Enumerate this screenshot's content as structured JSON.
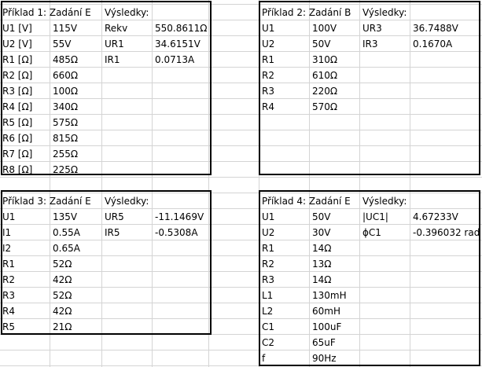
{
  "blocks": {
    "p1": {
      "title": "Příklad 1: Zadání E",
      "results_label": "Výsledky:",
      "inputs": [
        [
          "U1 [V]",
          "115V"
        ],
        [
          "U2 [V]",
          "55V"
        ],
        [
          "R1 [Ω]",
          "485Ω"
        ],
        [
          "R2 [Ω]",
          "660Ω"
        ],
        [
          "R3 [Ω]",
          "100Ω"
        ],
        [
          "R4 [Ω]",
          "340Ω"
        ],
        [
          "R5 [Ω]",
          "575Ω"
        ],
        [
          "R6 [Ω]",
          "815Ω"
        ],
        [
          "R7 [Ω]",
          "255Ω"
        ],
        [
          "R8 [Ω]",
          "225Ω"
        ]
      ],
      "results": [
        [
          "Rekv",
          "550.8611Ω"
        ],
        [
          "UR1",
          "34.6151V"
        ],
        [
          "IR1",
          "0.0713A"
        ]
      ]
    },
    "p2": {
      "title": "Příklad 2: Zadání B",
      "results_label": "Výsledky:",
      "inputs": [
        [
          "U1",
          "100V"
        ],
        [
          "U2",
          "50V"
        ],
        [
          "R1",
          "310Ω"
        ],
        [
          "R2",
          "610Ω"
        ],
        [
          "R3",
          "220Ω"
        ],
        [
          "R4",
          "570Ω"
        ]
      ],
      "results": [
        [
          "UR3",
          "36.7488V"
        ],
        [
          "IR3",
          "0.1670A"
        ]
      ]
    },
    "p3": {
      "title": "Příklad 3: Zadání E",
      "results_label": "Výsledky:",
      "inputs": [
        [
          "U1",
          "135V"
        ],
        [
          "I1",
          "0.55A"
        ],
        [
          "I2",
          "0.65A"
        ],
        [
          "R1",
          "52Ω"
        ],
        [
          "R2",
          "42Ω"
        ],
        [
          "R3",
          "52Ω"
        ],
        [
          "R4",
          "42Ω"
        ],
        [
          "R5",
          "21Ω"
        ]
      ],
      "results": [
        [
          "UR5",
          "-11.1469V"
        ],
        [
          "IR5",
          "-0.5308A"
        ]
      ]
    },
    "p4": {
      "title": "Příklad 4: Zadání E",
      "results_label": "Výsledky:",
      "inputs": [
        [
          "U1",
          "50V"
        ],
        [
          "U2",
          "30V"
        ],
        [
          "R1",
          "14Ω"
        ],
        [
          "R2",
          "13Ω"
        ],
        [
          "R3",
          "14Ω"
        ],
        [
          "L1",
          "130mH"
        ],
        [
          "L2",
          "60mH"
        ],
        [
          "C1",
          "100uF"
        ],
        [
          "C2",
          "65uF"
        ],
        [
          "f",
          "90Hz"
        ]
      ],
      "results": [
        [
          "|UC1|",
          "4.67233V"
        ],
        [
          "ϕC1",
          "-0.396032 rad"
        ]
      ]
    }
  },
  "colors": {
    "gridline": "#d4d4d4",
    "border": "#000000",
    "background": "#ffffff"
  }
}
